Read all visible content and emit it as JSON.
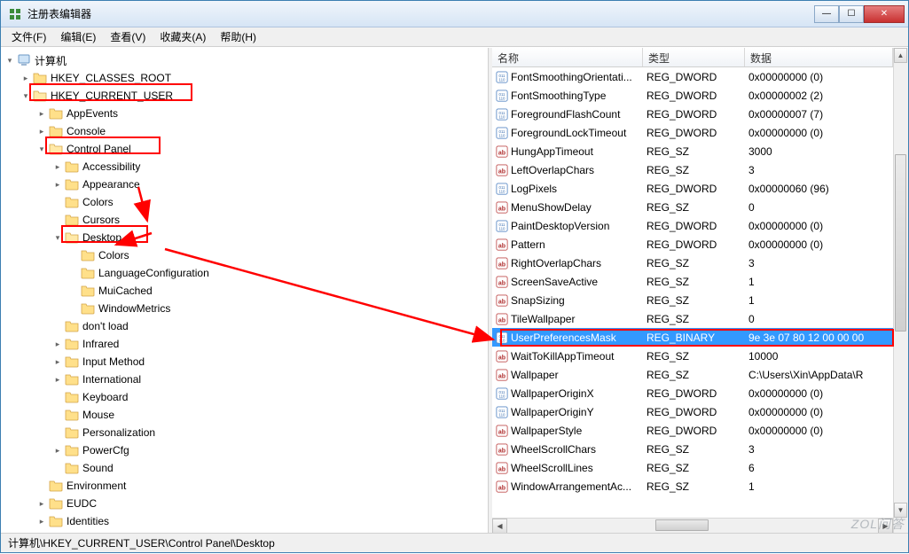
{
  "window": {
    "title": "注册表编辑器"
  },
  "menu": [
    "文件(F)",
    "编辑(E)",
    "查看(V)",
    "收藏夹(A)",
    "帮助(H)"
  ],
  "tree": {
    "root": "计算机",
    "items": [
      {
        "label": "HKEY_CLASSES_ROOT",
        "depth": 1,
        "expanded": false,
        "children": true
      },
      {
        "label": "HKEY_CURRENT_USER",
        "depth": 1,
        "expanded": true,
        "children": true,
        "highlight": true
      },
      {
        "label": "AppEvents",
        "depth": 2,
        "expanded": false,
        "children": true
      },
      {
        "label": "Console",
        "depth": 2,
        "expanded": false,
        "children": true
      },
      {
        "label": "Control Panel",
        "depth": 2,
        "expanded": true,
        "children": true,
        "highlight": true
      },
      {
        "label": "Accessibility",
        "depth": 3,
        "expanded": false,
        "children": true
      },
      {
        "label": "Appearance",
        "depth": 3,
        "expanded": false,
        "children": true
      },
      {
        "label": "Colors",
        "depth": 3,
        "expanded": false,
        "children": false
      },
      {
        "label": "Cursors",
        "depth": 3,
        "expanded": false,
        "children": false
      },
      {
        "label": "Desktop",
        "depth": 3,
        "expanded": true,
        "children": true,
        "highlight": true
      },
      {
        "label": "Colors",
        "depth": 4,
        "expanded": false,
        "children": false
      },
      {
        "label": "LanguageConfiguration",
        "depth": 4,
        "expanded": false,
        "children": false
      },
      {
        "label": "MuiCached",
        "depth": 4,
        "expanded": false,
        "children": false
      },
      {
        "label": "WindowMetrics",
        "depth": 4,
        "expanded": false,
        "children": false
      },
      {
        "label": "don't load",
        "depth": 3,
        "expanded": false,
        "children": false
      },
      {
        "label": "Infrared",
        "depth": 3,
        "expanded": false,
        "children": true
      },
      {
        "label": "Input Method",
        "depth": 3,
        "expanded": false,
        "children": true
      },
      {
        "label": "International",
        "depth": 3,
        "expanded": false,
        "children": true
      },
      {
        "label": "Keyboard",
        "depth": 3,
        "expanded": false,
        "children": false
      },
      {
        "label": "Mouse",
        "depth": 3,
        "expanded": false,
        "children": false
      },
      {
        "label": "Personalization",
        "depth": 3,
        "expanded": false,
        "children": false
      },
      {
        "label": "PowerCfg",
        "depth": 3,
        "expanded": false,
        "children": true
      },
      {
        "label": "Sound",
        "depth": 3,
        "expanded": false,
        "children": false
      },
      {
        "label": "Environment",
        "depth": 2,
        "expanded": false,
        "children": false
      },
      {
        "label": "EUDC",
        "depth": 2,
        "expanded": false,
        "children": true
      },
      {
        "label": "Identities",
        "depth": 2,
        "expanded": false,
        "children": true
      }
    ]
  },
  "list": {
    "headers": {
      "name": "名称",
      "type": "类型",
      "data": "数据"
    },
    "rows": [
      {
        "icon": "bin",
        "name": "FontSmoothingOrientati...",
        "type": "REG_DWORD",
        "data": "0x00000000 (0)"
      },
      {
        "icon": "bin",
        "name": "FontSmoothingType",
        "type": "REG_DWORD",
        "data": "0x00000002 (2)"
      },
      {
        "icon": "bin",
        "name": "ForegroundFlashCount",
        "type": "REG_DWORD",
        "data": "0x00000007 (7)"
      },
      {
        "icon": "bin",
        "name": "ForegroundLockTimeout",
        "type": "REG_DWORD",
        "data": "0x00000000 (0)"
      },
      {
        "icon": "str",
        "name": "HungAppTimeout",
        "type": "REG_SZ",
        "data": "3000"
      },
      {
        "icon": "str",
        "name": "LeftOverlapChars",
        "type": "REG_SZ",
        "data": "3"
      },
      {
        "icon": "bin",
        "name": "LogPixels",
        "type": "REG_DWORD",
        "data": "0x00000060 (96)"
      },
      {
        "icon": "str",
        "name": "MenuShowDelay",
        "type": "REG_SZ",
        "data": "0"
      },
      {
        "icon": "bin",
        "name": "PaintDesktopVersion",
        "type": "REG_DWORD",
        "data": "0x00000000 (0)"
      },
      {
        "icon": "str",
        "name": "Pattern",
        "type": "REG_DWORD",
        "data": "0x00000000 (0)"
      },
      {
        "icon": "str",
        "name": "RightOverlapChars",
        "type": "REG_SZ",
        "data": "3"
      },
      {
        "icon": "str",
        "name": "ScreenSaveActive",
        "type": "REG_SZ",
        "data": "1"
      },
      {
        "icon": "str",
        "name": "SnapSizing",
        "type": "REG_SZ",
        "data": "1"
      },
      {
        "icon": "str",
        "name": "TileWallpaper",
        "type": "REG_SZ",
        "data": "0"
      },
      {
        "icon": "bin",
        "name": "UserPreferencesMask",
        "type": "REG_BINARY",
        "data": "9e 3e 07 80 12 00 00 00",
        "selected": true,
        "highlight": true
      },
      {
        "icon": "str",
        "name": "WaitToKillAppTimeout",
        "type": "REG_SZ",
        "data": "10000"
      },
      {
        "icon": "str",
        "name": "Wallpaper",
        "type": "REG_SZ",
        "data": "C:\\Users\\Xin\\AppData\\R"
      },
      {
        "icon": "bin",
        "name": "WallpaperOriginX",
        "type": "REG_DWORD",
        "data": "0x00000000 (0)"
      },
      {
        "icon": "bin",
        "name": "WallpaperOriginY",
        "type": "REG_DWORD",
        "data": "0x00000000 (0)"
      },
      {
        "icon": "str",
        "name": "WallpaperStyle",
        "type": "REG_DWORD",
        "data": "0x00000000 (0)"
      },
      {
        "icon": "str",
        "name": "WheelScrollChars",
        "type": "REG_SZ",
        "data": "3"
      },
      {
        "icon": "str",
        "name": "WheelScrollLines",
        "type": "REG_SZ",
        "data": "6"
      },
      {
        "icon": "str",
        "name": "WindowArrangementAc...",
        "type": "REG_SZ",
        "data": "1"
      }
    ]
  },
  "statusbar": "计算机\\HKEY_CURRENT_USER\\Control Panel\\Desktop",
  "watermark": "ZOL问答"
}
